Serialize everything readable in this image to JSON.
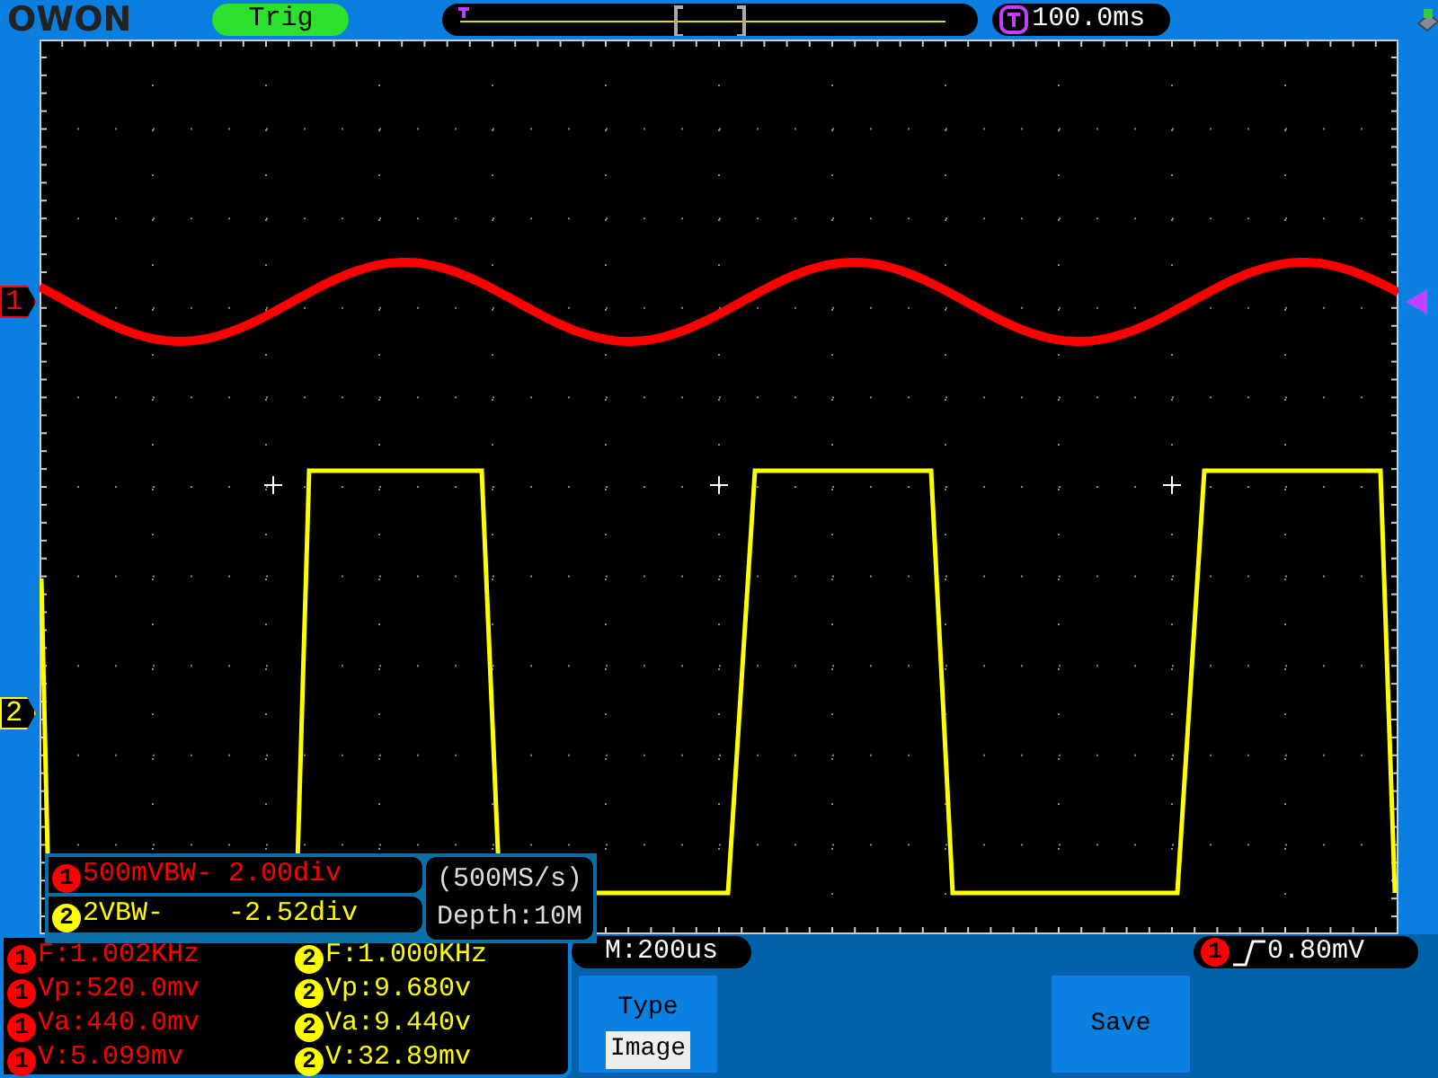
{
  "brand": "OWON",
  "status": "Trig",
  "trigger_time": "100.0ms",
  "channels": [
    {
      "marker": "1",
      "color": "#ff0000",
      "scale_badge": "1",
      "scale": "500mVBW- 2.00div",
      "measurements": [
        {
          "badge": "1",
          "value": "F:1.002KHz"
        },
        {
          "badge": "1",
          "value": "Vp:520.0mv"
        },
        {
          "badge": "1",
          "value": "Va:440.0mv"
        },
        {
          "badge": "1",
          "value": "V:5.099mv"
        }
      ]
    },
    {
      "marker": "2",
      "color": "#ffff00",
      "scale_badge": "2",
      "scale": "2VBW-    -2.52div",
      "measurements": [
        {
          "badge": "2",
          "value": "F:1.000KHz"
        },
        {
          "badge": "2",
          "value": "Vp:9.680v"
        },
        {
          "badge": "2",
          "value": "Va:9.440v"
        },
        {
          "badge": "2",
          "value": "V:32.89mv"
        }
      ]
    }
  ],
  "sample_rate": "(500MS/s)",
  "depth": "Depth:10M",
  "timebase": "M:200us",
  "trigger": {
    "source": "1",
    "level": "0.80mV"
  },
  "menu": [
    {
      "label": "Type",
      "value": "Image"
    },
    {
      "label": "Save"
    }
  ]
}
